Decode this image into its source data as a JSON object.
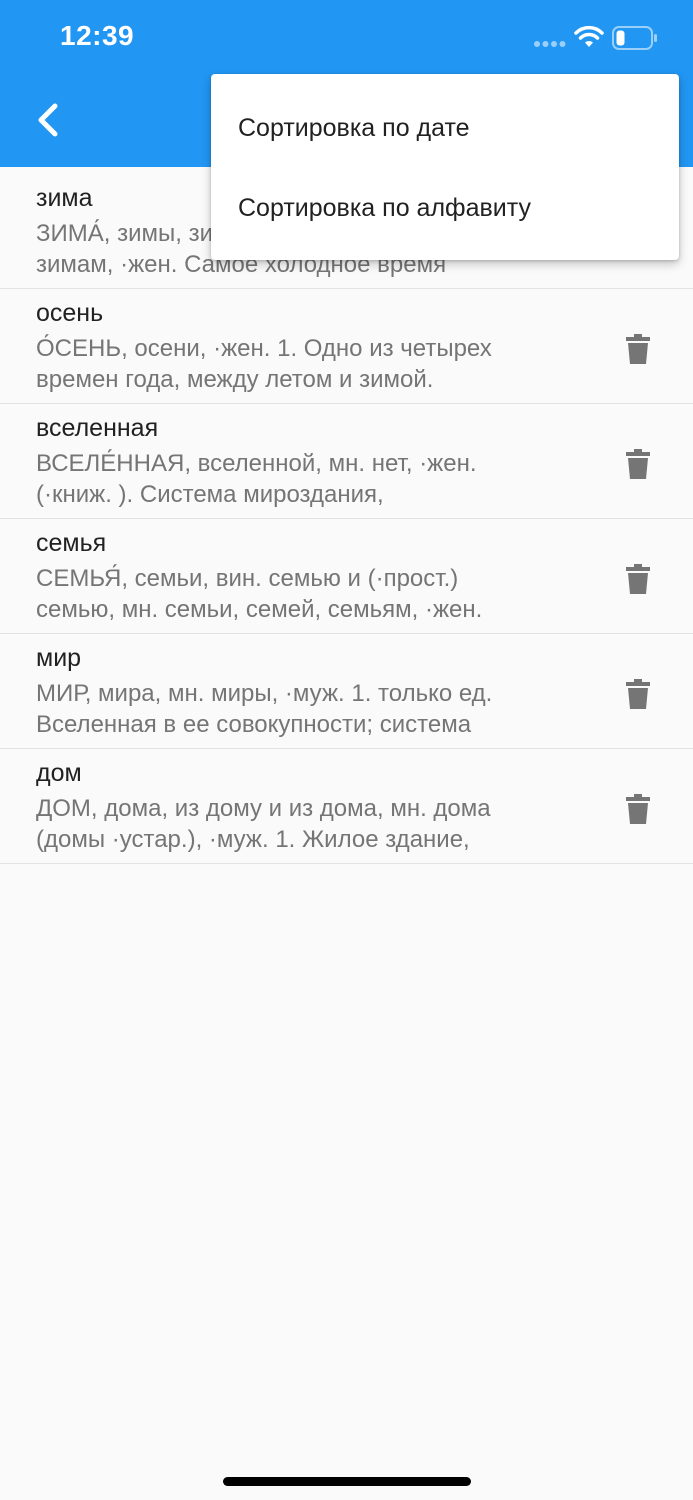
{
  "status_bar": {
    "time": "12:39"
  },
  "colors": {
    "appbar": "#2196f3",
    "word_text": "#212121",
    "definition_text": "#757575",
    "icon": "#757575"
  },
  "appbar": {
    "back_icon": "chevron-left-icon"
  },
  "menu": {
    "items": [
      {
        "label": "Сортировка по дате"
      },
      {
        "label": "Сортировка по алфавиту"
      }
    ]
  },
  "words": [
    {
      "word": "зима",
      "definition": "ЗИМА́, зимы, зиму, мн. зимы, зим,\nзимам, ·жен. Самое холодное время"
    },
    {
      "word": "осень",
      "definition": "О́СЕНЬ, осени, ·жен. 1. Одно из четырех\nвремен года, между летом и зимой."
    },
    {
      "word": "вселенная",
      "definition": "ВСЕЛЕ́ННАЯ, вселенной, мн. нет, ·жен.\n(·книж. ). Система мироздания,"
    },
    {
      "word": "семья",
      "definition": "СЕМЬЯ́, семьи, вин. семью и (·прост.)\nсемью, мн. семьи, семей, семьям, ·жен."
    },
    {
      "word": "мир",
      "definition": "МИР, мира, мн. миры, ·муж. 1. только ед.\nВселенная в ее совокупности; система"
    },
    {
      "word": "дом",
      "definition": "ДОМ, дома, из дому и из дома, мн. дома\n(домы ·устар.), ·муж. 1. Жилое здание,"
    }
  ]
}
